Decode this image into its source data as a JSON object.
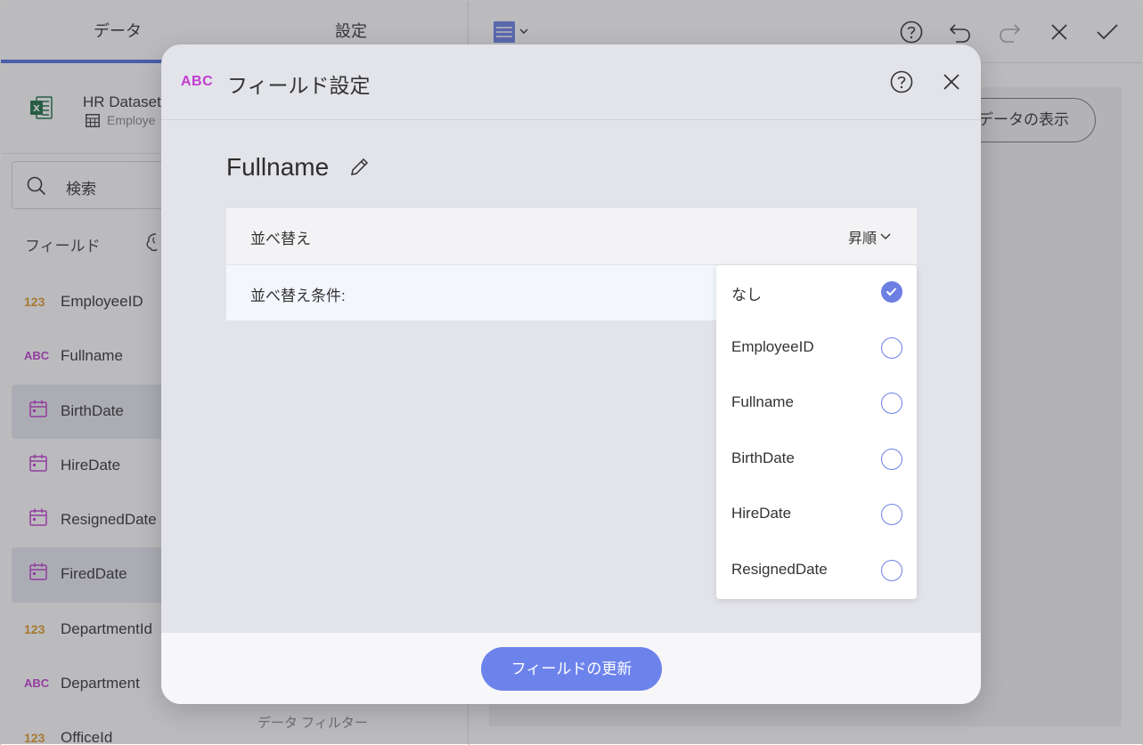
{
  "left_panel": {
    "tabs": [
      {
        "label": "データ"
      },
      {
        "label": "設定"
      }
    ],
    "dataset": {
      "name": "HR Dataset",
      "sheet": "Employe"
    },
    "search": {
      "placeholder": "検索"
    },
    "fields_header": "フィールド",
    "fields": [
      {
        "type": "123",
        "kind": "number",
        "name": "EmployeeID",
        "selected": false
      },
      {
        "type": "ABC",
        "kind": "text",
        "name": "Fullname",
        "selected": false
      },
      {
        "type": "calendar-icon",
        "kind": "date",
        "name": "BirthDate",
        "selected": true
      },
      {
        "type": "calendar-icon",
        "kind": "date",
        "name": "HireDate",
        "selected": false
      },
      {
        "type": "calendar-icon",
        "kind": "date",
        "name": "ResignedDate",
        "selected": false
      },
      {
        "type": "calendar-icon",
        "kind": "date",
        "name": "FiredDate",
        "selected": true
      },
      {
        "type": "123",
        "kind": "number",
        "name": "DepartmentId",
        "selected": false
      },
      {
        "type": "ABC",
        "kind": "text",
        "name": "Department",
        "selected": false
      },
      {
        "type": "123",
        "kind": "number",
        "name": "OfficeId",
        "selected": false
      }
    ],
    "data_filter": "データ フィルター"
  },
  "toolbar": {
    "icons": [
      "table-viz-icon",
      "help-icon",
      "undo-icon",
      "redo-icon",
      "close-icon",
      "check-icon"
    ],
    "show_data_label": "データの表示"
  },
  "dialog": {
    "type_badge": "ABC",
    "title": "フィールド設定",
    "field_name": "Fullname",
    "sort": {
      "label": "並べ替え",
      "order": "昇順",
      "condition_label": "並べ替え条件:",
      "options": [
        {
          "label": "なし",
          "checked": true
        },
        {
          "label": "EmployeeID",
          "checked": false
        },
        {
          "label": "Fullname",
          "checked": false
        },
        {
          "label": "BirthDate",
          "checked": false
        },
        {
          "label": "HireDate",
          "checked": false
        },
        {
          "label": "ResignedDate",
          "checked": false
        }
      ]
    },
    "update_button": "フィールドの更新"
  },
  "colors": {
    "accent": "#5471e0",
    "button": "#6d83ec",
    "text_type": "#c03ed0",
    "number_type": "#e09a2a"
  }
}
